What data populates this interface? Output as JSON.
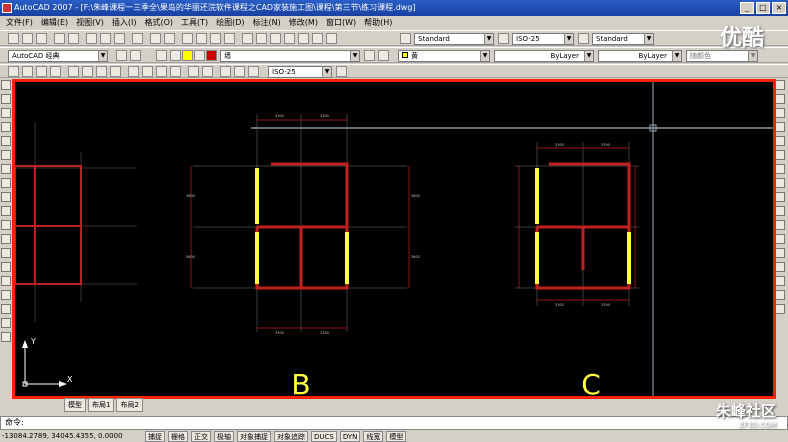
{
  "window": {
    "title": "AutoCAD 2007 - [F:\\朱峰课程一三季全\\果岛的华丽还浣软件课程之CAD家装施工图\\课程\\第三节\\练习课程.dwg]"
  },
  "menu": [
    "文件(F)",
    "编辑(E)",
    "视图(V)",
    "插入(I)",
    "格式(O)",
    "工具(T)",
    "绘图(D)",
    "标注(N)",
    "修改(M)",
    "窗口(W)",
    "帮助(H)"
  ],
  "toolbar": {
    "text_style": "Standard",
    "dim_style": "ISO-25",
    "table_style": "Standard",
    "workspace": "AutoCAD 经典",
    "layer": "墙",
    "color": "黄",
    "linetype": "ByLayer",
    "lineweight": "ByLayer",
    "plotstyle": "随颜色",
    "dim_style2": "ISO-25"
  },
  "drawing": {
    "label_b": "B",
    "label_c": "C"
  },
  "ucs": {
    "x": "X",
    "y": "Y"
  },
  "layout_tabs": [
    "模型",
    "布局1",
    "布局2"
  ],
  "command": {
    "prompt": "命令:"
  },
  "status": {
    "coords": "-13084.2789, 34045.4355, 0.0000",
    "buttons": [
      "捕捉",
      "栅格",
      "正交",
      "极轴",
      "对象捕捉",
      "对象追踪",
      "DUCS",
      "DYN",
      "线宽",
      "模型"
    ]
  },
  "watermark": {
    "top": "优酷",
    "bottom": "朱峰社区",
    "bottom_url": "ZF3D.COM"
  }
}
